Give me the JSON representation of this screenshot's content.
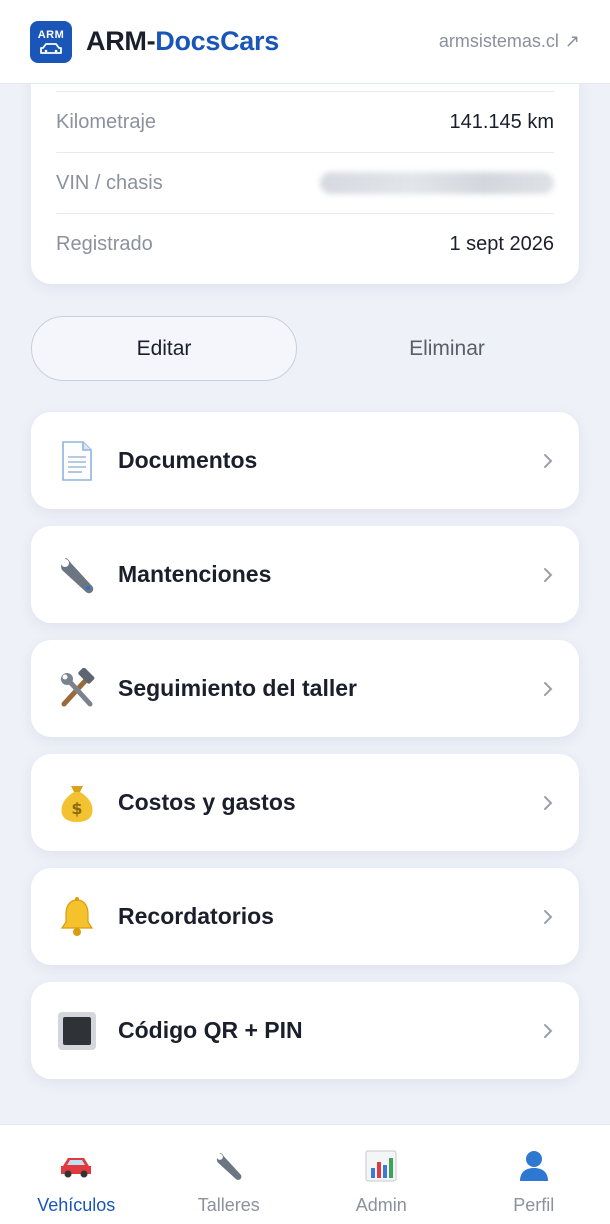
{
  "header": {
    "logo_text": "ARM",
    "brand_part1": "ARM-",
    "brand_part2": "DocsCars",
    "external_link": "armsistemas.cl",
    "external_arrow": "↗"
  },
  "vehicle_info": {
    "rows": [
      {
        "label": "Kilometraje",
        "value": "141.145 km"
      },
      {
        "label": "VIN / chasis",
        "value": "",
        "redacted": true
      },
      {
        "label": "Registrado",
        "value": "1 sept 2026"
      }
    ]
  },
  "actions": {
    "edit_label": "Editar",
    "delete_label": "Eliminar"
  },
  "menu": {
    "items": [
      {
        "label": "Documentos",
        "icon": "document-icon"
      },
      {
        "label": "Mantenciones",
        "icon": "wrench-icon"
      },
      {
        "label": "Seguimiento del taller",
        "icon": "hammer-wrench-icon"
      },
      {
        "label": "Costos y gastos",
        "icon": "money-bag-icon"
      },
      {
        "label": "Recordatorios",
        "icon": "bell-icon"
      },
      {
        "label": "Código QR + PIN",
        "icon": "qr-square-icon"
      }
    ]
  },
  "bottom_nav": {
    "items": [
      {
        "label": "Vehículos",
        "icon": "car-icon",
        "active": true
      },
      {
        "label": "Talleres",
        "icon": "wrench-icon",
        "active": false
      },
      {
        "label": "Admin",
        "icon": "bar-chart-icon",
        "active": false
      },
      {
        "label": "Perfil",
        "icon": "user-icon",
        "active": false
      }
    ]
  },
  "colors": {
    "accent": "#1a56b8",
    "background": "#eef1f8",
    "card": "#ffffff",
    "muted_text": "#8b919d"
  }
}
